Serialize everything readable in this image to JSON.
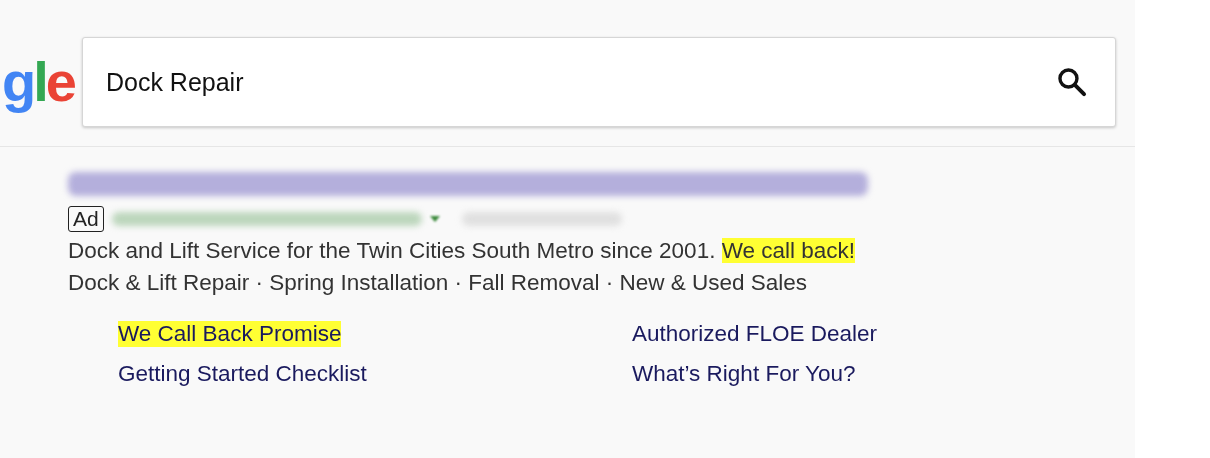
{
  "logo": {
    "letters": "gle"
  },
  "search": {
    "value": "Dock Repair"
  },
  "ad": {
    "badge": "Ad",
    "description": [
      {
        "text": "Dock and Lift Service for the Twin Cities South Metro since 2001.",
        "highlighted": false
      },
      {
        "text": "We call back!",
        "highlighted": true
      }
    ],
    "callouts": "Dock & Lift Repair · Spring Installation · Fall Removal · New & Used Sales",
    "sitelinks": [
      {
        "label": "We Call Back Promise",
        "highlighted": true
      },
      {
        "label": "Authorized FLOE Dealer",
        "highlighted": false
      },
      {
        "label": "Getting Started Checklist",
        "highlighted": false
      },
      {
        "label": "What’s Right For You?",
        "highlighted": false
      }
    ]
  }
}
